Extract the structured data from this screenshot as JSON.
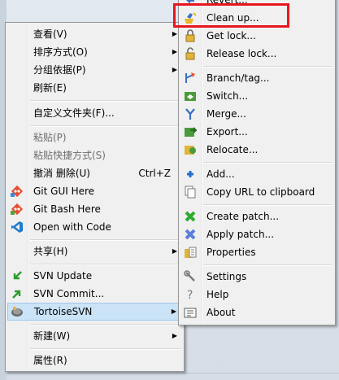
{
  "main_menu": {
    "view": "查看(V)",
    "sort_by": "排序方式(O)",
    "group_by": "分组依据(P)",
    "refresh": "刷新(E)",
    "customize_folder": "自定义文件夹(F)...",
    "paste": "粘贴(P)",
    "paste_shortcut": "粘贴快捷方式(S)",
    "undo_delete": "撤消 删除(U)",
    "undo_shortcut": "Ctrl+Z",
    "git_gui": "Git GUI Here",
    "git_bash": "Git Bash Here",
    "open_with_code": "Open with Code",
    "share": "共享(H)",
    "svn_update": "SVN Update",
    "svn_commit": "SVN Commit...",
    "tortoise_svn": "TortoiseSVN",
    "new": "新建(W)",
    "properties": "属性(R)"
  },
  "svn_submenu": {
    "revert": "Revert...",
    "clean_up": "Clean up...",
    "get_lock": "Get lock...",
    "release_lock": "Release lock...",
    "branch_tag": "Branch/tag...",
    "switch": "Switch...",
    "merge": "Merge...",
    "export": "Export...",
    "relocate": "Relocate...",
    "add": "Add...",
    "copy_url": "Copy URL to clipboard",
    "create_patch": "Create patch...",
    "apply_patch": "Apply patch...",
    "properties": "Properties",
    "settings": "Settings",
    "help": "Help",
    "about": "About"
  },
  "colors": {
    "menu_bg": "#f0f0f0",
    "highlight_red": "#e8161d",
    "selected_bg": "#cbe3f6"
  }
}
